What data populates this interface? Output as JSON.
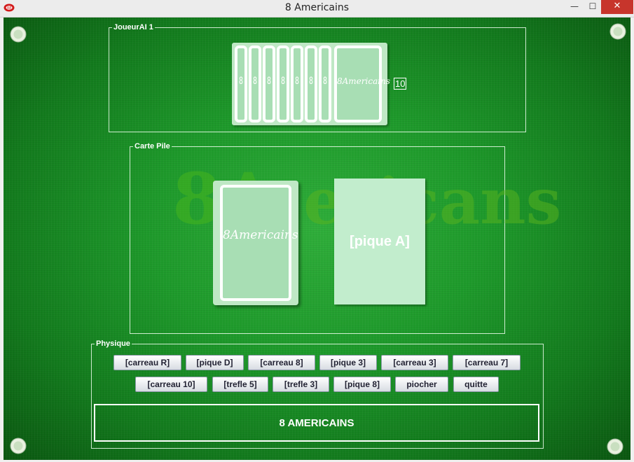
{
  "window": {
    "title": "8 Americains",
    "minimize": "—",
    "maximize": "☐",
    "close": "✕"
  },
  "ai_panel": {
    "legend": "JoueurAI 1",
    "card_count": "10",
    "back_mini_label": "8",
    "back_label": "8Americains"
  },
  "pile_panel": {
    "legend": "Carte Pile",
    "watermark_main": "8A",
    "watermark_tail": "ericans",
    "deck_label": "8Americains",
    "top_card": "[pique A]"
  },
  "player_panel": {
    "legend": "Physique",
    "row1": [
      "[carreau R]",
      "[pique D]",
      "[carreau 8]",
      "[pique 3]",
      "[carreau 3]",
      "[carreau 7]"
    ],
    "row2": [
      "[carreau 10]",
      "[trefle 5]",
      "[trefle 3]",
      "[pique 8]",
      "piocher",
      "quitte"
    ],
    "banner": "8 AMERICAINS"
  },
  "colors": {
    "felt": "#1e9a2b",
    "card_back": "#a8deb4",
    "pile_card": "#c2edcd",
    "close_button": "#c7352c"
  },
  "icons": {
    "app": "cards-icon",
    "corners": "poker-chip-icon"
  }
}
